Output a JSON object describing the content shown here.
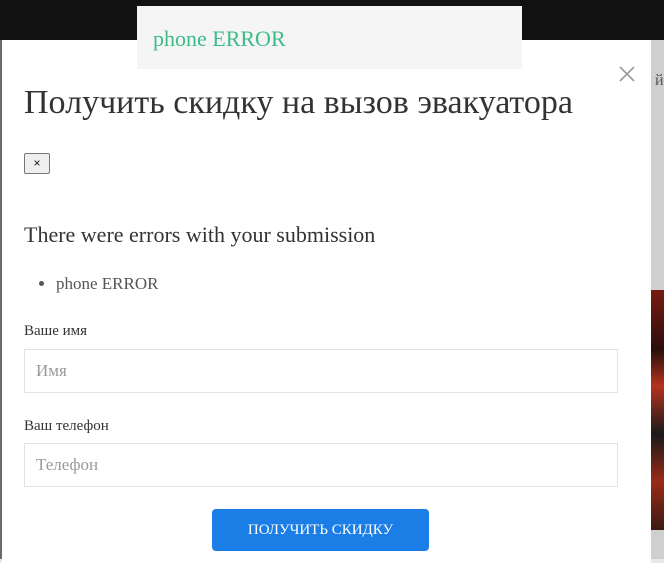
{
  "toast": {
    "message": "phone ERROR"
  },
  "background": {
    "partial_text": "й"
  },
  "modal": {
    "title": "Получить скидку на вызов эвакуатора",
    "inline_close_label": "×",
    "errors_heading": "There were errors with your submission",
    "errors": [
      "phone ERROR"
    ],
    "form": {
      "name_label": "Ваше имя",
      "name_placeholder": "Имя",
      "phone_label": "Ваш телефон",
      "phone_placeholder": "Телефон",
      "submit_label": "ПОЛУЧИТЬ СКИДКУ"
    }
  },
  "colors": {
    "toast_text": "#3dbb8a",
    "button": "#1b7ee6",
    "topbar": "#111111"
  }
}
